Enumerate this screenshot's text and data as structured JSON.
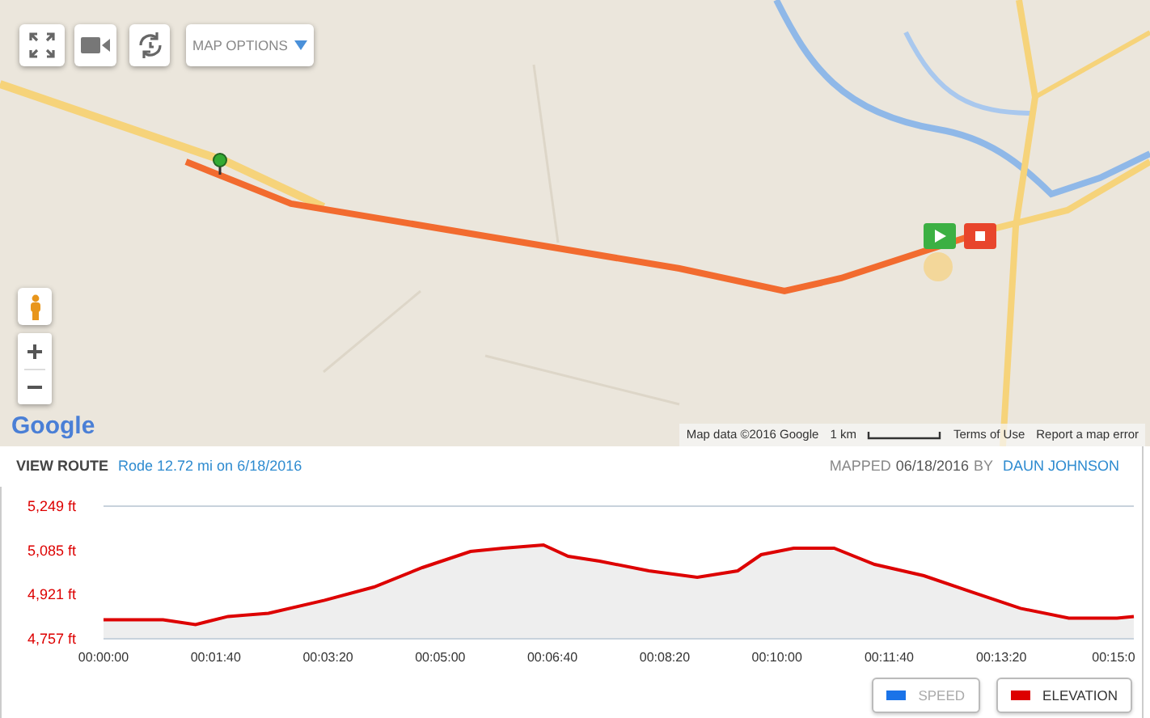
{
  "map": {
    "controls": {
      "map_options": "MAP OPTIONS"
    },
    "attribution": {
      "logo": "Google",
      "map_data": "Map data ©2016 Google",
      "scale": "1 km",
      "terms": "Terms of Use",
      "report": "Report a map error"
    }
  },
  "route": {
    "label": "VIEW ROUTE",
    "summary": "Rode 12.72 mi on 6/18/2016",
    "mapped_label": "MAPPED",
    "mapped_date": "06/18/2016",
    "by": "BY",
    "author": "DAUN JOHNSON"
  },
  "chart_data": {
    "type": "area",
    "x": [
      0,
      53,
      82,
      111,
      147,
      197,
      241,
      284,
      327,
      356,
      392,
      414,
      442,
      486,
      529,
      565,
      586,
      615,
      651,
      687,
      731,
      774,
      817,
      860,
      903,
      918
    ],
    "series": [
      {
        "color": "#dd0000",
        "values": [
          4828,
          4828,
          4810,
          4840,
          4852,
          4900,
          4949,
          5021,
          5081,
          5093,
          5105,
          5063,
          5045,
          5009,
          4985,
          5009,
          5069,
          5093,
          5093,
          5033,
          4991,
          4930,
          4870,
          4834,
          4834,
          4840
        ]
      }
    ],
    "xlim": [
      0,
      918
    ],
    "ylim": [
      4757,
      5249
    ],
    "yticks": [
      {
        "value": 5249,
        "label": "5,249 ft"
      },
      {
        "value": 5085,
        "label": "5,085 ft"
      },
      {
        "value": 4921,
        "label": "4,921 ft"
      },
      {
        "value": 4757,
        "label": "4,757 ft"
      }
    ],
    "xticks": [
      {
        "value": 0,
        "label": "00:00:00"
      },
      {
        "value": 100,
        "label": "00:01:40"
      },
      {
        "value": 200,
        "label": "00:03:20"
      },
      {
        "value": 300,
        "label": "00:05:00"
      },
      {
        "value": 400,
        "label": "00:06:40"
      },
      {
        "value": 500,
        "label": "00:08:20"
      },
      {
        "value": 600,
        "label": "00:10:00"
      },
      {
        "value": 700,
        "label": "00:11:40"
      },
      {
        "value": 800,
        "label": "00:13:20"
      },
      {
        "value": 900,
        "label": "00:15:0"
      }
    ]
  },
  "legend": [
    {
      "label": "SPEED",
      "color": "#1a73e8",
      "on": false
    },
    {
      "label": "ELEVATION",
      "color": "#dd0000",
      "on": true
    }
  ]
}
